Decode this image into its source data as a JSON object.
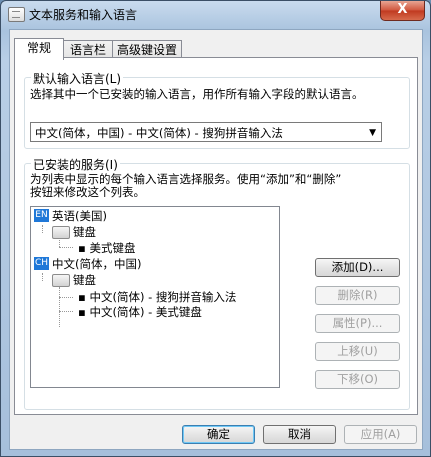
{
  "window": {
    "title": "文本服务和输入语言",
    "close_label": "X"
  },
  "tabs": [
    {
      "label": "常规",
      "active": true
    },
    {
      "label": "语言栏",
      "active": false
    },
    {
      "label": "高级键设置",
      "active": false
    }
  ],
  "default_language": {
    "group_title": "默认输入语言(L)",
    "description": "选择其中一个已安装的输入语言，用作所有输入字段的默认语言。",
    "selected": "中文(简体，中国) - 中文(简体) - 搜狗拼音输入法"
  },
  "installed_services": {
    "group_title": "已安装的服务(I)",
    "description_line1": "为列表中显示的每个输入语言选择服务。使用“添加”和“删除”",
    "description_line2": "按钮来修改这个列表。",
    "tree": {
      "lang1": {
        "badge": "EN",
        "label": "英语(美国)"
      },
      "lang1_keyboard": "键盘",
      "lang1_item1": "美式键盘",
      "lang2": {
        "badge": "CH",
        "label": "中文(简体，中国)"
      },
      "lang2_keyboard": "键盘",
      "lang2_item1": "中文(简体) - 搜狗拼音输入法",
      "lang2_item2": "中文(简体) - 美式键盘"
    },
    "buttons": {
      "add": "添加(D)...",
      "remove": "删除(R)",
      "properties": "属性(P)...",
      "move_up": "上移(U)",
      "move_down": "下移(O)"
    }
  },
  "footer": {
    "ok": "确定",
    "cancel": "取消",
    "apply": "应用(A)"
  }
}
